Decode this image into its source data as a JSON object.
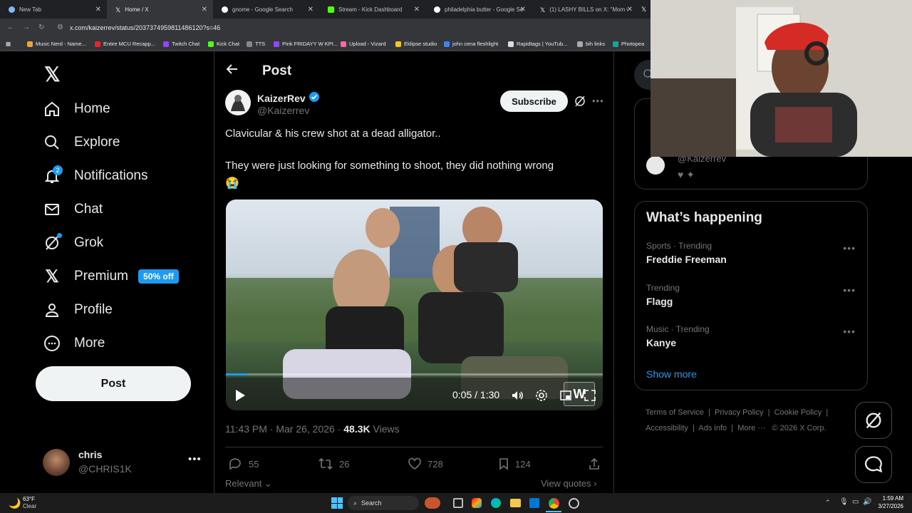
{
  "browser": {
    "tabs": [
      {
        "title": "New Tab",
        "color": "#8ab4f8"
      },
      {
        "title": "Home / X",
        "color": "#ffffff"
      },
      {
        "title": "gnome - Google Search",
        "color": "#4285f4"
      },
      {
        "title": "Stream - Kick Dashboard",
        "color": "#53fc18"
      },
      {
        "title": "philadelphia butter - Google Se",
        "color": "#4285f4"
      },
      {
        "title": "(1) LASHY BILLS on X: \"Mom w",
        "color": "#ffffff"
      }
    ],
    "url": "x.com/kaizerrev/status/2037374959811486120?s=46",
    "bookmarks": [
      "Music Nerd - Name...",
      "Entire MCU Recapp...",
      "Twitch Chat",
      "Kick Chat",
      "TTS",
      "Pink FRIDAYY W KPI...",
      "Upload - Vizard",
      "Eklipse studio",
      "john cena fleshlight",
      "Rapidtags | YouTub...",
      "bih links",
      "Photopea"
    ]
  },
  "nav": {
    "items": [
      "Home",
      "Explore",
      "Notifications",
      "Chat",
      "Grok",
      "Premium",
      "Profile",
      "More"
    ],
    "notifications_badge": "2",
    "premium_badge": "50% off",
    "post_button": "Post",
    "user": {
      "name": "chris",
      "handle": "@CHRIS1K"
    }
  },
  "post": {
    "header": "Post",
    "author_name": "KaizerRev",
    "author_handle": "@Kaizerrev",
    "subscribe": "Subscribe",
    "text_line1": "Clavicular & his crew shot at a dead alligator..",
    "text_line2": "They were just looking for something to shoot, they did nothing wrong",
    "emoji": "😭",
    "video_time": "0:05 / 1:30",
    "watermark": "W",
    "timestamp": "11:43 PM · Mar 26, 2026 · ",
    "views_count": "48.3K",
    "views_label": " Views",
    "replies": "55",
    "reposts": "26",
    "likes": "728",
    "bookmarks": "124",
    "relevant": "Relevant",
    "view_quotes": "View quotes"
  },
  "right": {
    "partial_handle": "@Kaizerrev",
    "whats_happening": "What’s happening",
    "trends": [
      {
        "meta": "Sports · Trending",
        "name": "Freddie Freeman"
      },
      {
        "meta": "Trending",
        "name": "Flagg"
      },
      {
        "meta": "Music · Trending",
        "name": "Kanye"
      }
    ],
    "show_more": "Show more",
    "footer": [
      "Terms of Service",
      "Privacy Policy",
      "Cookie Policy",
      "Accessibility",
      "Ads info",
      "More ···",
      "© 2026 X Corp."
    ]
  },
  "taskbar": {
    "weather_temp": "63°F",
    "weather_cond": "Clear",
    "search": "Search",
    "time": "1:59 AM",
    "date": "3/27/2026"
  },
  "colors": {
    "accent": "#1d9bf0",
    "bg": "#000000",
    "muted": "#71767b"
  }
}
